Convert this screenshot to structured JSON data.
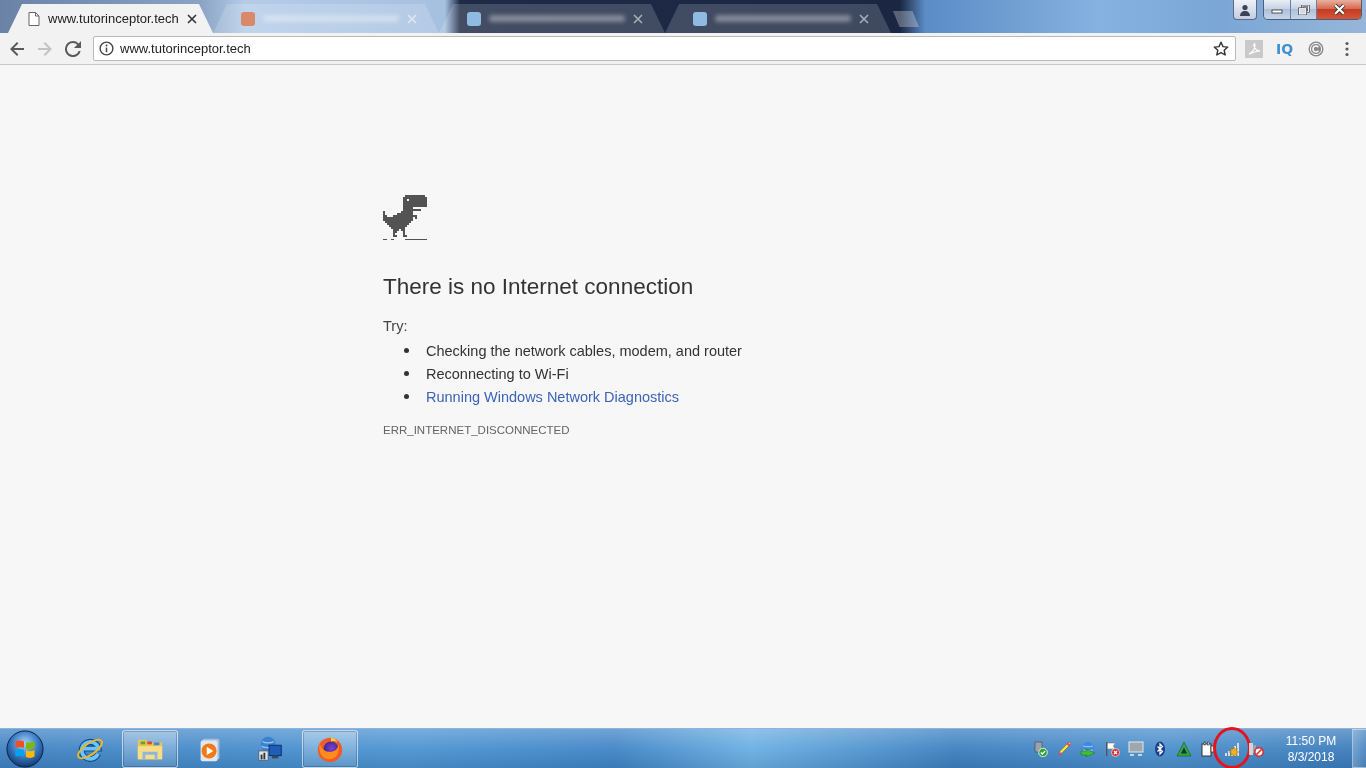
{
  "tabs": [
    {
      "title": "www.tutorinceptor.tech",
      "selected": true
    },
    {
      "selected": false,
      "color": "#d9896a"
    },
    {
      "selected": false,
      "color": "#8fbbe2"
    },
    {
      "selected": false,
      "color": "#8fbbe2"
    }
  ],
  "toolbar": {
    "back_disabled": false,
    "forward_disabled": true,
    "address": "www.tutorinceptor.tech",
    "bookmarked": false,
    "extensions": [
      {
        "kind": "tile"
      },
      {
        "kind": "label",
        "label": "IQ"
      },
      {
        "kind": "c-circle"
      }
    ]
  },
  "error_page": {
    "heading": "There is no Internet connection",
    "try_label": "Try:",
    "suggestions": [
      {
        "kind": "text",
        "text": "Checking the network cables, modem, and router"
      },
      {
        "kind": "text",
        "text": "Reconnecting to Wi-Fi"
      },
      {
        "kind": "link",
        "text": "Running Windows Network Diagnostics"
      }
    ],
    "error_code": "ERR_INTERNET_DISCONNECTED"
  },
  "taskbar": {
    "apps": [
      {
        "kind": "browser",
        "running": false
      },
      {
        "kind": "folder",
        "running": true
      },
      {
        "kind": "player",
        "running": false
      },
      {
        "kind": "network",
        "running": false
      },
      {
        "kind": "firefox",
        "running": true
      }
    ],
    "tray_icons": [
      {
        "kind": "usb",
        "highlighted": false
      },
      {
        "kind": "pen",
        "highlighted": false
      },
      {
        "kind": "download",
        "highlighted": false
      },
      {
        "kind": "flag",
        "highlighted": false
      },
      {
        "kind": "monitor",
        "highlighted": false
      },
      {
        "kind": "bluetooth",
        "highlighted": false
      },
      {
        "kind": "triangle",
        "highlighted": false
      },
      {
        "kind": "plug",
        "highlighted": false
      },
      {
        "kind": "signal",
        "highlighted": true
      },
      {
        "kind": "blocked",
        "highlighted": false
      }
    ],
    "clock": {
      "time": "11:50 PM",
      "date": "8/3/2018"
    }
  }
}
